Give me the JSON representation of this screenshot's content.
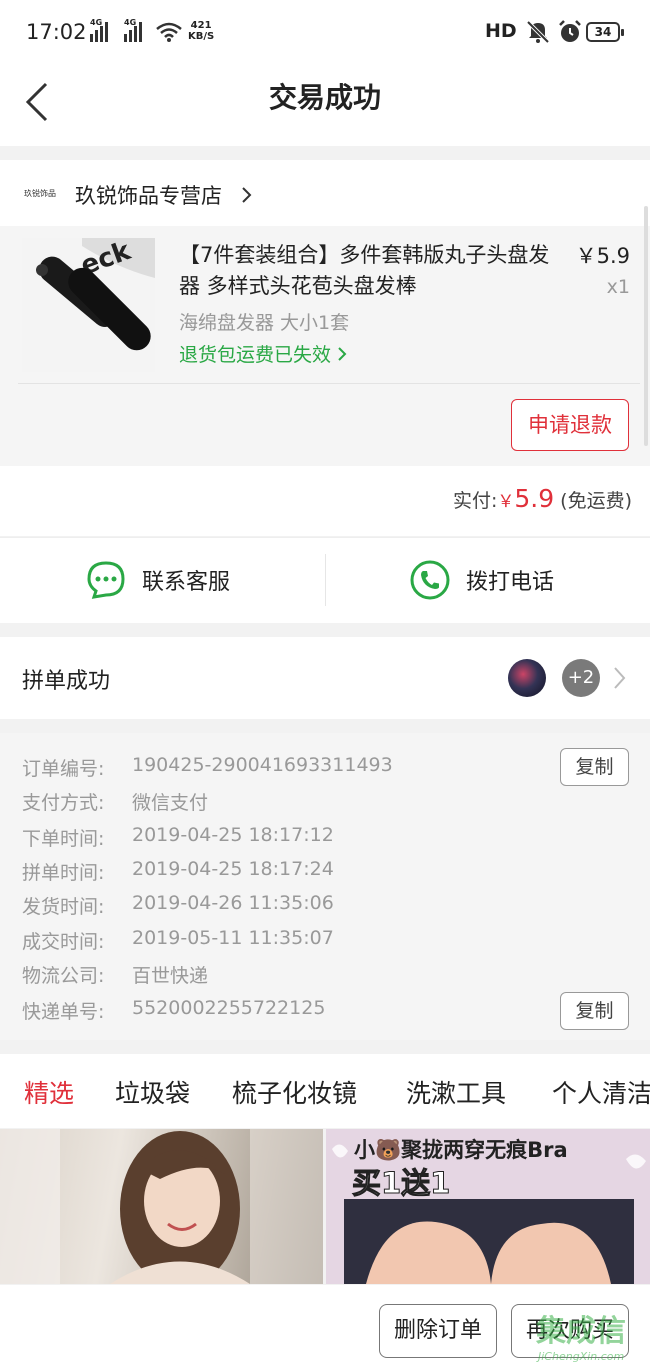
{
  "status_bar": {
    "time": "17:02",
    "net1": "4G",
    "net2": "4G",
    "speed_value": "421",
    "speed_unit": "KB/S",
    "hd": "HD",
    "battery": "34"
  },
  "header": {
    "title": "交易成功"
  },
  "shop": {
    "logo_text": "玖锐饰品",
    "name": "玖锐饰品专营店"
  },
  "product": {
    "name": "【7件套装组合】多件套韩版丸子头盘发器 多样式头花苞头盘发棒",
    "price": "￥5.9",
    "quantity": "x1",
    "spec": "海绵盘发器 大小1套",
    "return_note": "退货包运费已失效",
    "refund_button": "申请退款"
  },
  "payment": {
    "paid_label": "实付:",
    "currency": "￥",
    "amount": "5.9",
    "shipping_note": "(免运费)"
  },
  "contact": {
    "service_label": "联系客服",
    "phone_label": "拨打电话"
  },
  "group": {
    "label": "拼单成功",
    "extra_count": "+2"
  },
  "order_info": {
    "rows": [
      {
        "key": "订单编号:",
        "value": "190425-290041693311493"
      },
      {
        "key": "支付方式:",
        "value": "微信支付"
      },
      {
        "key": "下单时间:",
        "value": "2019-04-25 18:17:12"
      },
      {
        "key": "拼单时间:",
        "value": "2019-04-25 18:17:24"
      },
      {
        "key": "发货时间:",
        "value": "2019-04-26 11:35:06"
      },
      {
        "key": "成交时间:",
        "value": "2019-05-11 11:35:07"
      },
      {
        "key": "物流公司:",
        "value": "百世快递"
      },
      {
        "key": "快递单号:",
        "value": "5520002255722125"
      }
    ],
    "copy_label": "复制"
  },
  "recommend": {
    "tabs": [
      "精选",
      "垃圾袋",
      "梳子化妆镜",
      "洗漱工具",
      "个人清洁"
    ],
    "banner_line1": "小🐻聚拢两穿无痕Bra",
    "banner_line2": "买1送1"
  },
  "actions": {
    "delete_order": "删除订单",
    "buy_again": "再次购买"
  },
  "watermark": {
    "line1": "集成信",
    "line2": "JiChengXin.com"
  },
  "colors": {
    "accent_red": "#e0303a",
    "green": "#2aa845"
  }
}
